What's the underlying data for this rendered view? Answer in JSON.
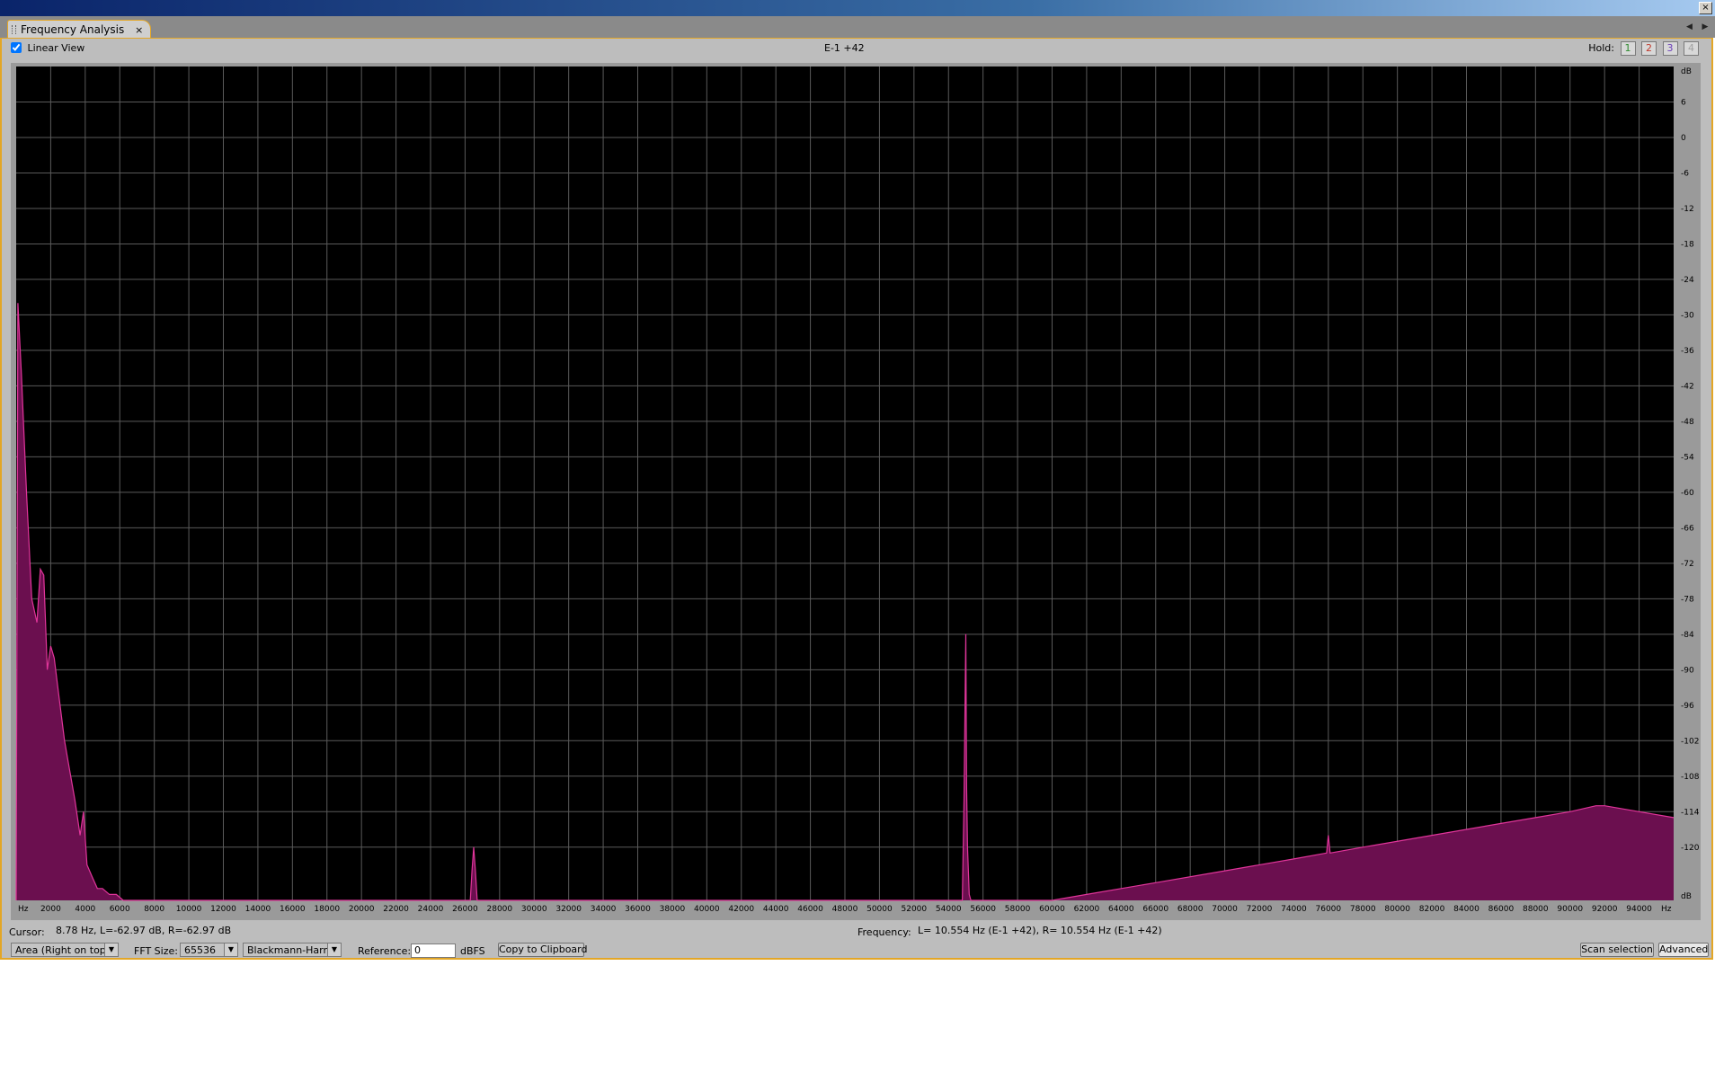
{
  "window": {
    "close_glyph": "×"
  },
  "tab": {
    "label": "Frequency Analysis",
    "close_glyph": "×",
    "nav_left": "◀",
    "nav_right": "▶"
  },
  "toolbar": {
    "linear_view_label": "Linear View",
    "linear_view_checked": true,
    "mode_label": "E-1 +42",
    "hold_label": "Hold:",
    "hold_buttons": [
      "1",
      "2",
      "3",
      "4"
    ],
    "hold_colors": [
      "#2e8b2e",
      "#c0392b",
      "#6a3db8",
      "#a0a0a0"
    ]
  },
  "status": {
    "cursor_label": "Cursor:",
    "cursor_value": "8.78 Hz, L=-62.97 dB, R=-62.97 dB",
    "frequency_label": "Frequency:",
    "frequency_value": "L= 10.554 Hz (E-1 +42), R= 10.554 Hz (E-1 +42)"
  },
  "controls": {
    "plot_mode": "Area (Right on top)",
    "fft_size_label": "FFT Size:",
    "fft_size": "65536",
    "window_function": "Blackmann-Harris",
    "reference_label": "Reference:",
    "reference_value": "0",
    "reference_unit": "dBFS",
    "copy_button": "Copy to Clipboard",
    "scan_button": "Scan selection",
    "advanced_button": "Advanced"
  },
  "colors": {
    "spectrum_fill": "#6b0f4f",
    "spectrum_line": "#e0359a",
    "plot_bg": "#000000",
    "grid": "#5a5a5a",
    "accent": "#e3a626"
  },
  "chart_data": {
    "type": "area",
    "xlabel": "Hz",
    "ylabel": "dB",
    "xlim": [
      0,
      96000
    ],
    "ylim": [
      -129,
      12
    ],
    "grid": true,
    "x_ticks": [
      "2000",
      "4000",
      "6000",
      "8000",
      "10000",
      "12000",
      "14000",
      "16000",
      "18000",
      "20000",
      "22000",
      "24000",
      "26000",
      "28000",
      "30000",
      "32000",
      "34000",
      "36000",
      "38000",
      "40000",
      "42000",
      "44000",
      "46000",
      "48000",
      "50000",
      "52000",
      "54000",
      "56000",
      "58000",
      "60000",
      "62000",
      "64000",
      "66000",
      "68000",
      "70000",
      "72000",
      "74000",
      "76000",
      "78000",
      "80000",
      "82000",
      "84000",
      "86000",
      "88000",
      "90000",
      "92000",
      "94000"
    ],
    "y_ticks": [
      "6",
      "0",
      "-6",
      "-12",
      "-18",
      "-24",
      "-30",
      "-36",
      "-42",
      "-48",
      "-54",
      "-60",
      "-66",
      "-72",
      "-78",
      "-84",
      "-90",
      "-96",
      "-102",
      "-108",
      "-114",
      "-120"
    ],
    "series": [
      {
        "x": [
          0,
          100,
          300,
          600,
          900,
          1200,
          1400,
          1600,
          1800,
          2000,
          2200,
          2500,
          2800,
          3100,
          3400,
          3700,
          3900,
          4100,
          4400,
          4700,
          5000,
          5400,
          5800,
          6200,
          6400,
          26300,
          26400,
          26500,
          26600,
          26700,
          54800,
          54900,
          55000,
          55050,
          55100,
          55200,
          55300,
          60000,
          62000,
          66000,
          70000,
          74000,
          75900,
          76000,
          76100,
          78000,
          82000,
          86000,
          88000,
          90000,
          91500,
          92000,
          94000,
          96000
        ],
        "y": [
          -129,
          -28,
          -40,
          -60,
          -78,
          -82,
          -73,
          -74,
          -90,
          -86,
          -88,
          -95,
          -102,
          -107,
          -112,
          -118,
          -114,
          -123,
          -125,
          -127,
          -127,
          -128,
          -128,
          -129,
          -129,
          -129,
          -124,
          -120,
          -124,
          -129,
          -129,
          -112,
          -84,
          -110,
          -120,
          -128,
          -129,
          -129,
          -128,
          -126,
          -124,
          -122,
          -121,
          -118,
          -121,
          -120,
          -118,
          -116,
          -115,
          -114,
          -113,
          -113,
          -114,
          -115
        ]
      }
    ]
  }
}
